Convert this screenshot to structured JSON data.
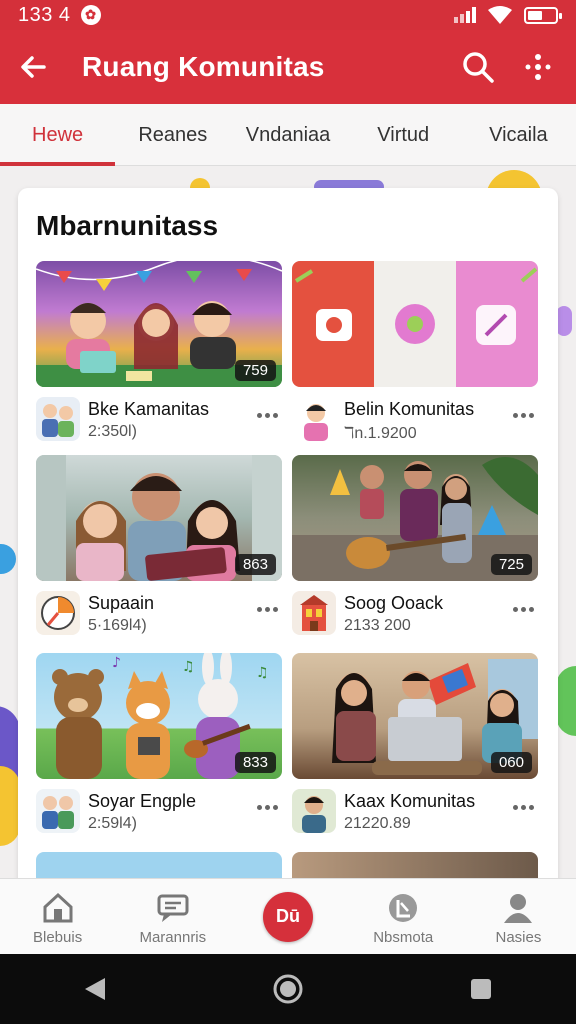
{
  "status": {
    "time": "133 4",
    "notification_badge": "✿"
  },
  "appbar": {
    "title": "Ruang Komunitas",
    "search_icon": "search-icon",
    "more_icon": "more-icon"
  },
  "tabs": [
    {
      "label": "Hewe"
    },
    {
      "label": "Reanes"
    },
    {
      "label": "Vndaniaa"
    },
    {
      "label": "Virtud"
    },
    {
      "label": "Vicaila"
    }
  ],
  "section": {
    "title": "Mbarnunitass"
  },
  "items": [
    {
      "name": "Bke Kamanitas",
      "sub": "2:350Ɩ)",
      "badge": "759",
      "thumb": "kids-classroom"
    },
    {
      "name": "Belin Komunitas",
      "sub": "ℸn.1.9200",
      "badge": "",
      "thumb": "app-icons"
    },
    {
      "name": "Supaain",
      "sub": "5·169Ɩ4)",
      "badge": "863",
      "thumb": "family-tablet"
    },
    {
      "name": "Soog Ooack",
      "sub": "2133 200",
      "badge": "725",
      "thumb": "guitar-group"
    },
    {
      "name": "Soyar Engple",
      "sub": "2:59Ɩ4)",
      "badge": "833",
      "thumb": "cartoon-animals"
    },
    {
      "name": "Kaax Komunitas",
      "sub": "21220.89",
      "badge": "060",
      "thumb": "study-laptop"
    }
  ],
  "bottom_nav": [
    {
      "label": "Blebuis",
      "icon": "home-icon"
    },
    {
      "label": "Marannris",
      "icon": "chat-icon"
    },
    {
      "label": "Dū",
      "icon": "create-icon"
    },
    {
      "label": "Nbsmota",
      "icon": "notification-icon"
    },
    {
      "label": "Nasies",
      "icon": "profile-icon"
    }
  ],
  "colors": {
    "brand": "#d8303b",
    "active_tab": "#d0323b"
  }
}
